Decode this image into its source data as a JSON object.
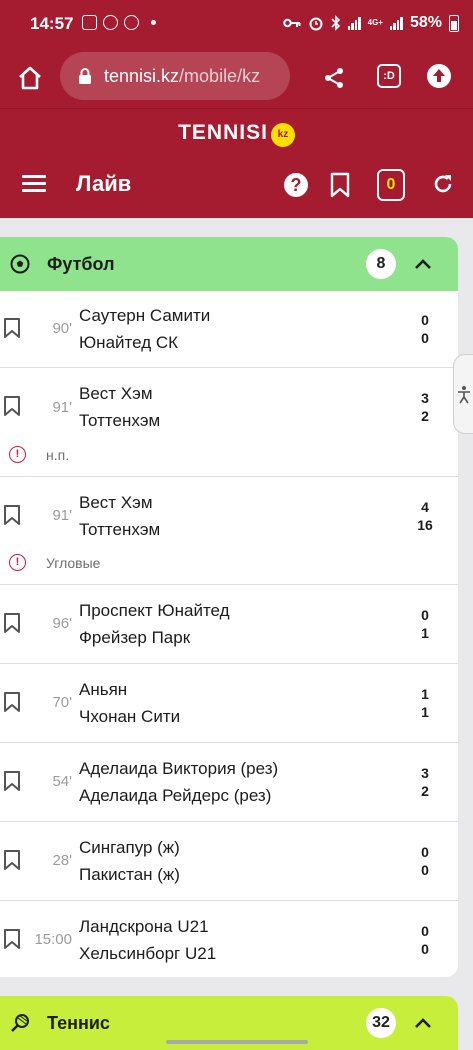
{
  "status_bar": {
    "time": "14:57",
    "network": "4G+",
    "battery": "58%"
  },
  "browser": {
    "url_host": "tennisi.kz",
    "url_path": "/mobile/kz",
    "tabs_label": ":D"
  },
  "site": {
    "logo_text": "TENNISI",
    "logo_badge": "kz"
  },
  "header": {
    "title": "Лайв",
    "help_label": "?",
    "coupon_count": "0"
  },
  "football": {
    "title": "Футбол",
    "count": "8",
    "matches": [
      {
        "time": "90'",
        "team1": "Саутерн Самити",
        "team2": "Юнайтед СК",
        "score1": "0",
        "score2": "0"
      },
      {
        "time": "91'",
        "team1": "Вест Хэм",
        "team2": "Тоттенхэм",
        "score1": "3",
        "score2": "2",
        "note": "н.п."
      },
      {
        "time": "91'",
        "team1": "Вест Хэм",
        "team2": "Тоттенхэм",
        "score1": "4",
        "score2": "16",
        "note": "Угловые"
      },
      {
        "time": "96'",
        "team1": "Проспект Юнайтед",
        "team2": "Фрейзер Парк",
        "score1": "0",
        "score2": "1"
      },
      {
        "time": "70'",
        "team1": "Аньян",
        "team2": "Чхонан Сити",
        "score1": "1",
        "score2": "1"
      },
      {
        "time": "54'",
        "team1": "Аделаида Виктория (рез)",
        "team2": "Аделаида Рейдерс (рез)",
        "score1": "3",
        "score2": "2"
      },
      {
        "time": "28'",
        "team1": "Сингапур (ж)",
        "team2": "Пакистан (ж)",
        "score1": "0",
        "score2": "0"
      },
      {
        "time": "15:00",
        "team1": "Ландскрона U21",
        "team2": "Хельсинборг U21",
        "score1": "0",
        "score2": "0"
      }
    ]
  },
  "tennis": {
    "title": "Теннис",
    "count": "32"
  },
  "note_icon_glyph": "!",
  "colors": {
    "brand": "#a51c30",
    "football_header": "#8ee38c",
    "tennis_header": "#c8ee3c",
    "accent_yellow": "#fedf00"
  }
}
